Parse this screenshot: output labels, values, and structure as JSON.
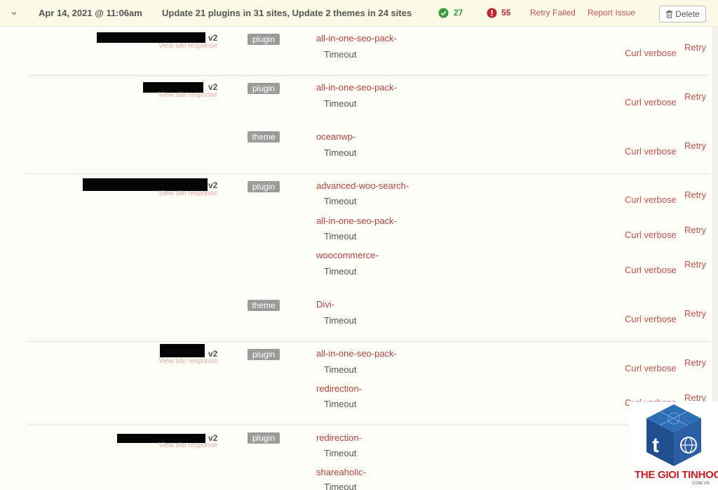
{
  "header": {
    "date": "Apr 14, 2021 @ 11:06am",
    "summary": "Update 21 plugins in 31 sites, Update 2 themes in 24 sites",
    "success_count": "27",
    "failed_count": "55",
    "retry_failed_label": "Retry Failed",
    "report_issue_label": "Report Issue",
    "delete_label": "Delete"
  },
  "common": {
    "version": "v2",
    "view_site_response": "View site response",
    "curl_verbose": "Curl verbose",
    "retry": "Retry",
    "status_timeout": "Timeout",
    "type_plugin": "plugin",
    "type_theme": "theme"
  },
  "sites": [
    {
      "items": [
        {
          "type": "plugin",
          "name": "all-in-one-seo-pack-",
          "status": "Timeout"
        }
      ]
    },
    {
      "items": [
        {
          "type": "plugin",
          "name": "all-in-one-seo-pack-",
          "status": "Timeout"
        },
        {
          "type": "theme",
          "name": "oceanwp-",
          "status": "Timeout"
        }
      ]
    },
    {
      "items": [
        {
          "type": "plugin",
          "name": "advanced-woo-search-",
          "status": "Timeout"
        },
        {
          "type": "",
          "name": "all-in-one-seo-pack-",
          "status": "Timeout"
        },
        {
          "type": "",
          "name": "woocommerce-",
          "status": "Timeout"
        },
        {
          "type": "theme",
          "name": "Divi-",
          "status": "Timeout"
        }
      ]
    },
    {
      "items": [
        {
          "type": "plugin",
          "name": "all-in-one-seo-pack-",
          "status": "Timeout"
        },
        {
          "type": "",
          "name": "redirection-",
          "status": "Timeout"
        }
      ]
    },
    {
      "items": [
        {
          "type": "plugin",
          "name": "redirection-",
          "status": "Timeout"
        },
        {
          "type": "",
          "name": "shareaholic-",
          "status": "Timeout"
        }
      ]
    }
  ],
  "watermark": {
    "brand": "THE GIOI TINHOC",
    "domain": ".COM.VN"
  },
  "colors": {
    "link": "#b0413e",
    "success": "#3c9a3c",
    "error": "#c0272d",
    "tag": "#9b9b9b",
    "header_bg": "#fcfbe8"
  },
  "icons": {
    "collapse": "chevron-down-icon",
    "success": "check-circle-icon",
    "failed": "exclamation-circle-icon",
    "delete": "trash-icon"
  }
}
